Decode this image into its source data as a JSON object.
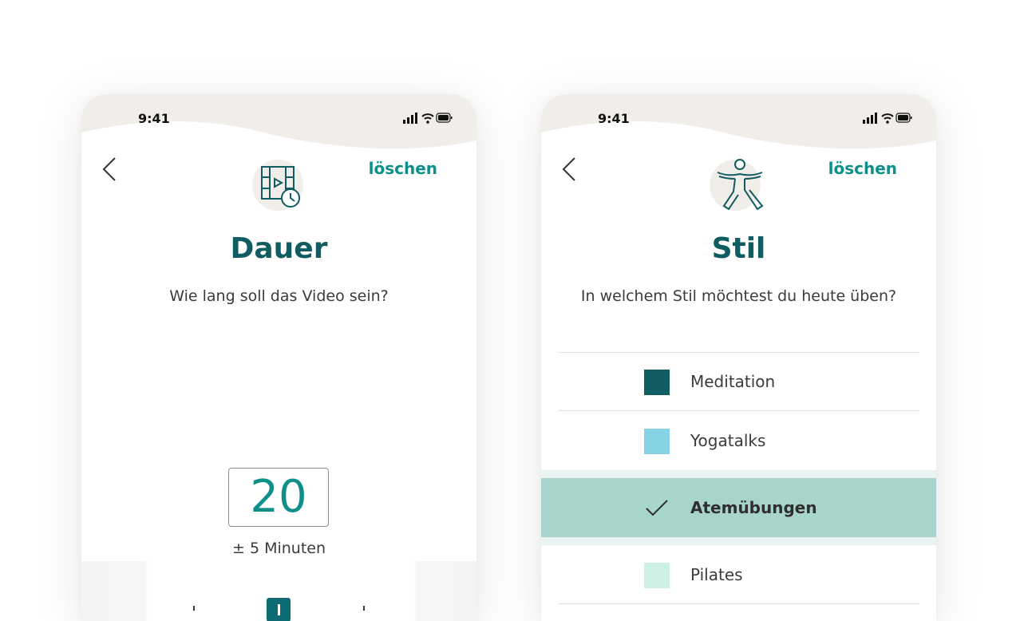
{
  "colors": {
    "accent": "#0e8f8a",
    "title": "#0f5c62",
    "status_wave": "#f1ede8",
    "selected_row": "#a8d5cb"
  },
  "left_screen": {
    "status": {
      "time": "9:41"
    },
    "clear_label": "löschen",
    "icon": "video-clock-icon",
    "title": "Dauer",
    "subtitle": "Wie lang soll das Video sein?",
    "value": "20",
    "tolerance": "± 5 Minuten"
  },
  "right_screen": {
    "status": {
      "time": "9:41"
    },
    "clear_label": "löschen",
    "icon": "yoga-pose-icon",
    "title": "Stil",
    "subtitle": "In welchem Stil möchtest du heute üben?",
    "styles": [
      {
        "label": "Meditation",
        "color": "#0f5c62",
        "selected": false
      },
      {
        "label": "Yogatalks",
        "color": "#86d3e4",
        "selected": false
      },
      {
        "label": "Atemübungen",
        "color": "#a8d5cb",
        "selected": true
      },
      {
        "label": "Pilates",
        "color": "#cdf0e6",
        "selected": false
      }
    ]
  }
}
